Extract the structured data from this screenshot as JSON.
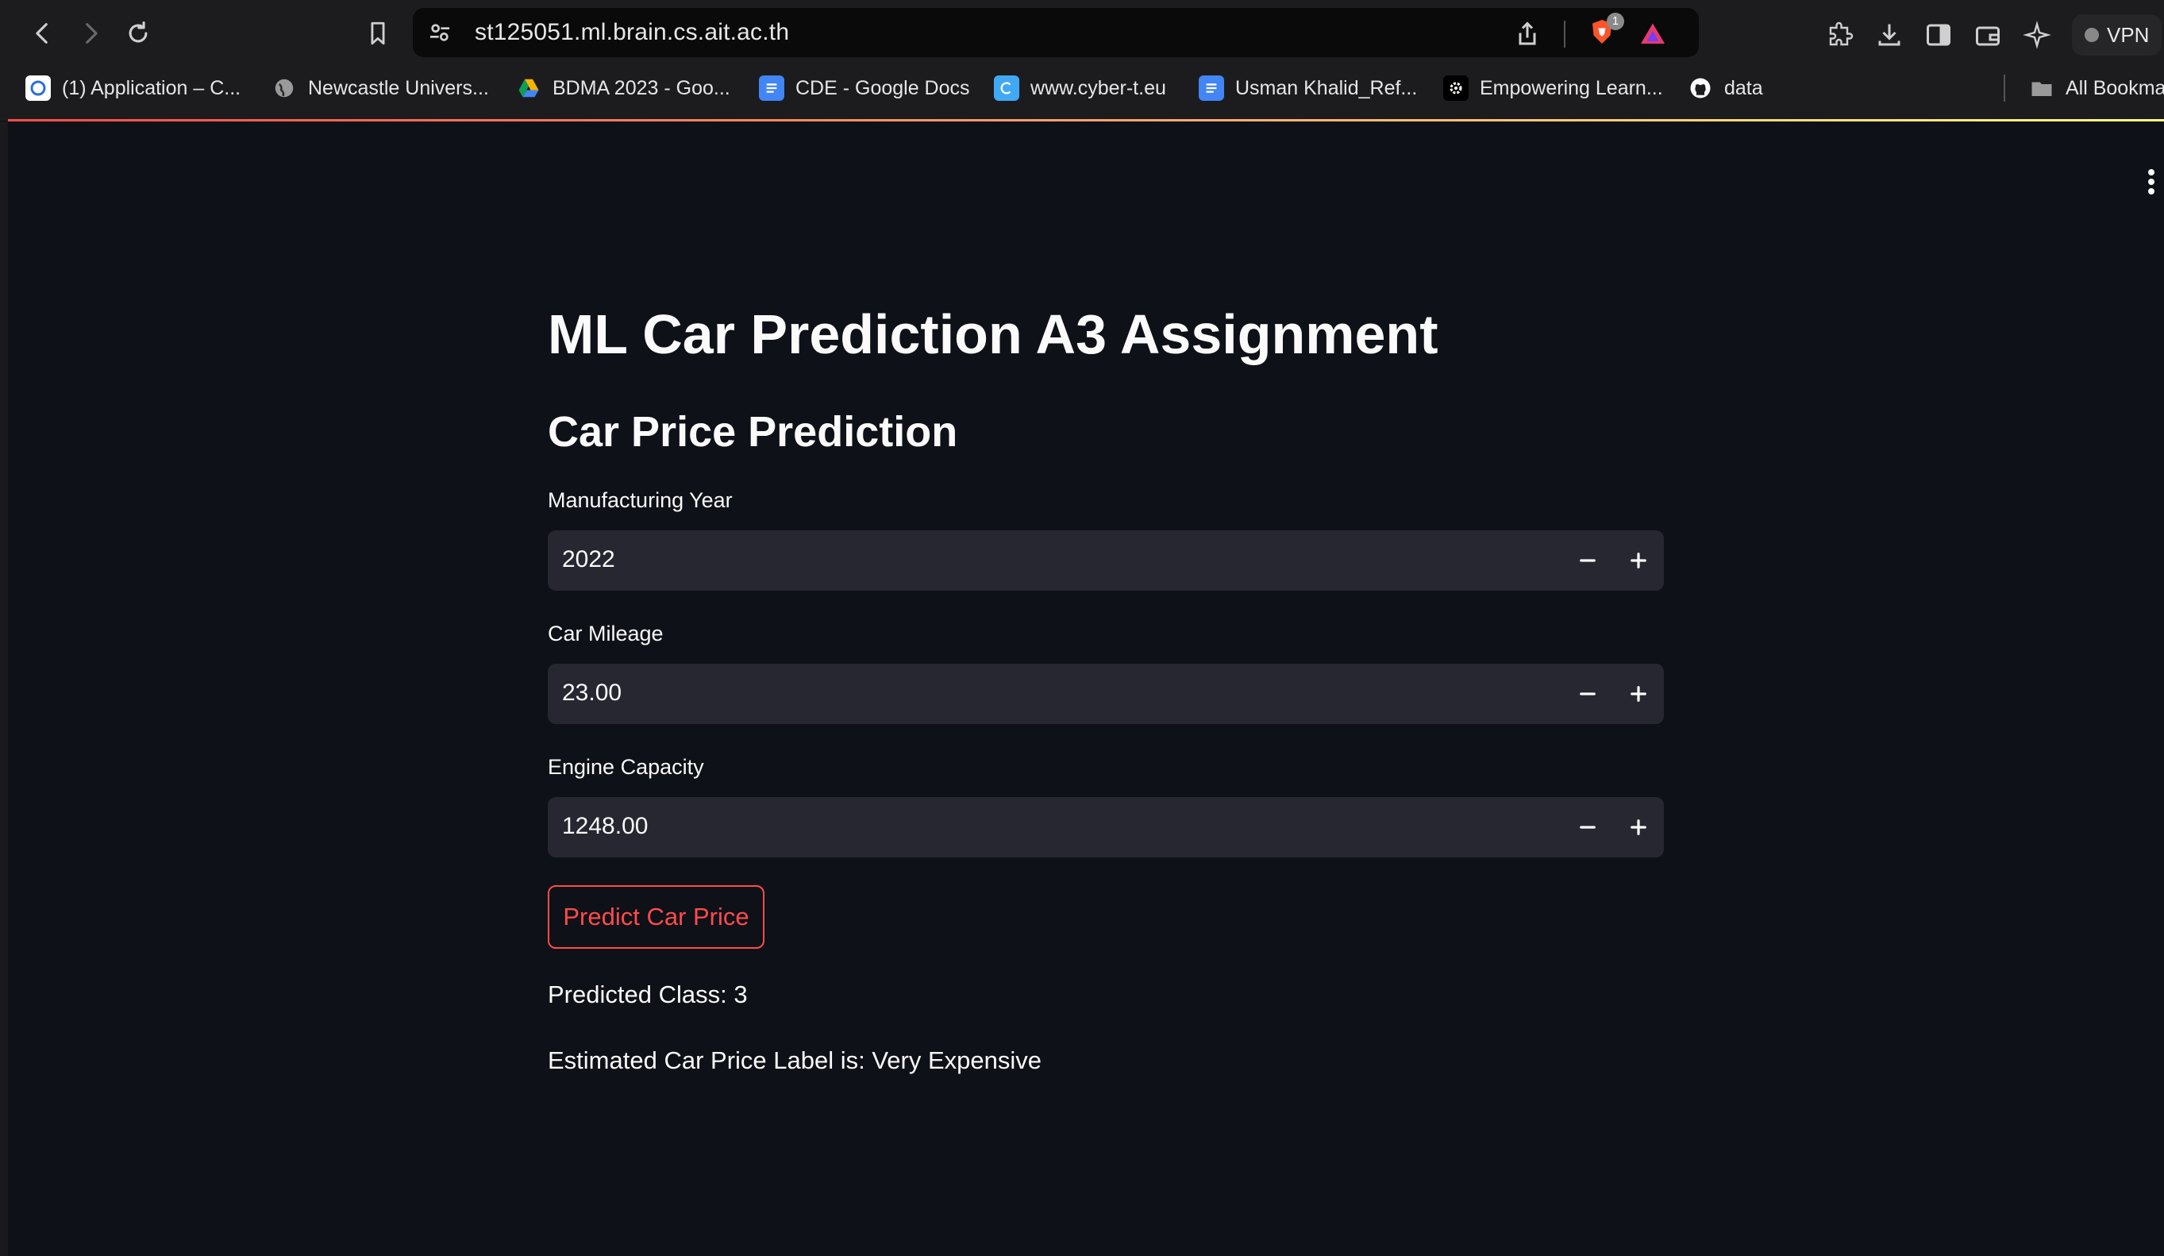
{
  "browser": {
    "url": "st125051.ml.brain.cs.ait.ac.th",
    "shield_count": "1",
    "vpn_label": "VPN",
    "bookmarks": [
      {
        "label": "(1) Application – C...",
        "icon": "app-icon"
      },
      {
        "label": "Newcastle Univers...",
        "icon": "globe-icon"
      },
      {
        "label": "BDMA 2023 - Goo...",
        "icon": "google-drive-icon"
      },
      {
        "label": "CDE - Google Docs",
        "icon": "google-docs-icon"
      },
      {
        "label": "www.cyber-t.eu",
        "icon": "cyber-icon"
      },
      {
        "label": "Usman Khalid_Ref...",
        "icon": "google-docs-icon"
      },
      {
        "label": "Empowering Learn...",
        "icon": "gear-icon"
      },
      {
        "label": "data",
        "icon": "github-icon"
      }
    ],
    "all_bookmarks": "All Bookma"
  },
  "app": {
    "title": "ML Car Prediction A3 Assignment",
    "subtitle": "Car Price Prediction",
    "inputs": [
      {
        "label": "Manufacturing Year",
        "value": "2022"
      },
      {
        "label": "Car Mileage",
        "value": "23.00"
      },
      {
        "label": "Engine Capacity",
        "value": "1248.00"
      }
    ],
    "button_label": "Predict Car Price",
    "predicted_class": "Predicted Class: 3",
    "price_label": "Estimated Car Price Label is: Very Expensive"
  },
  "colors": {
    "background": "#0e1117",
    "input_bg": "#262730",
    "accent": "#ff4b4b"
  }
}
